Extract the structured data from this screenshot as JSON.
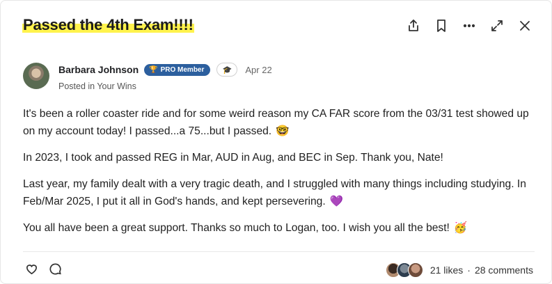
{
  "post": {
    "title": "Passed the 4th Exam!!!!",
    "author": {
      "name": "Barbara Johnson",
      "badge": "PRO Member",
      "badge_icon": "trophy-icon",
      "secondary_badge_icon": "graduation-cap-icon",
      "date": "Apr 22",
      "posted_in": "Posted in Your Wins"
    },
    "paragraphs": [
      {
        "text": "It's been a roller coaster ride and for some weird reason my CA FAR score from the 03/31 test showed up on my account today!  I passed...a 75...but I passed.",
        "emoji": "🤓"
      },
      {
        "text": "In 2023, I took and passed REG in Mar, AUD in Aug, and BEC in Sep.  Thank you, Nate!",
        "emoji": ""
      },
      {
        "text": "Last year, my family dealt with a very tragic death, and I struggled with many things including studying.  In Feb/Mar 2025, I put it all in God's hands, and kept persevering.",
        "emoji": "💜"
      },
      {
        "text": "You all have been a great support.  Thanks so much to Logan, too.  I wish you all the best!",
        "emoji": "🥳"
      }
    ],
    "likes_label": "21 likes",
    "separator": "·",
    "comments_label": "28 comments"
  },
  "toolbar": {
    "icons": [
      "share-icon",
      "bookmark-icon",
      "more-icon",
      "expand-icon",
      "close-icon"
    ]
  },
  "colors": {
    "highlight": "#fff34d",
    "badge_bg": "#2c5f9e"
  }
}
